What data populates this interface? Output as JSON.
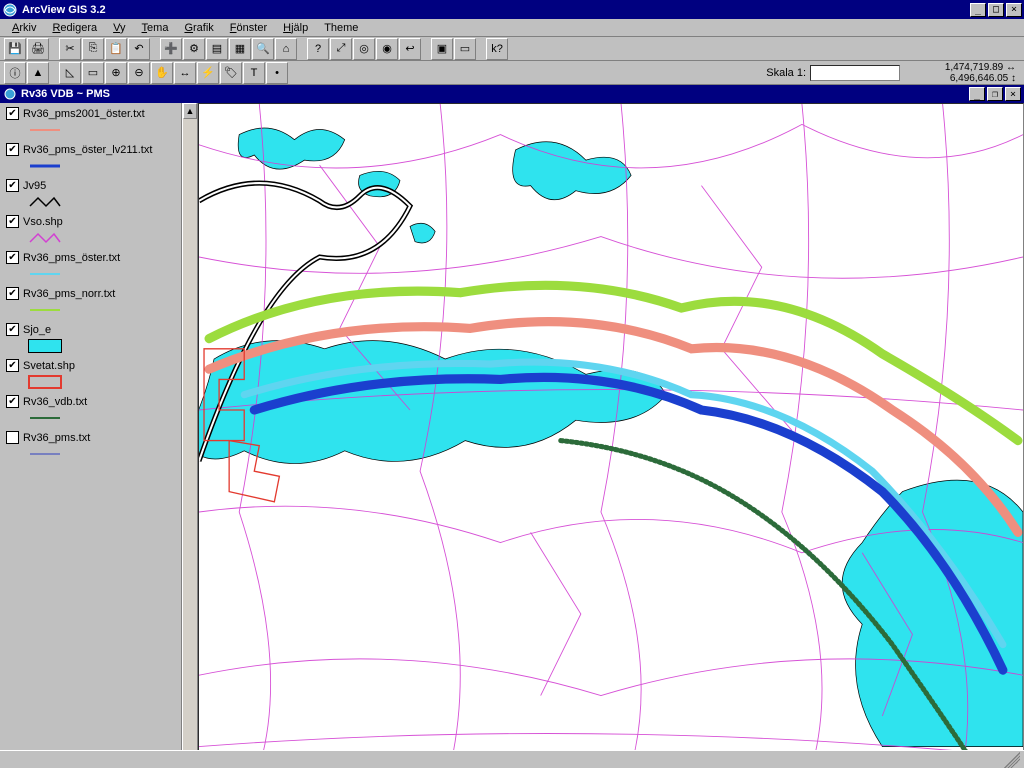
{
  "app": {
    "title": "ArcView GIS 3.2",
    "child_title": "Rv36 VDB ~ PMS"
  },
  "menu": {
    "items": [
      "Arkiv",
      "Redigera",
      "Vy",
      "Tema",
      "Grafik",
      "Fönster",
      "Hjälp",
      "Theme"
    ]
  },
  "toolbar1_icons": [
    "save-icon",
    "print-icon",
    "sep",
    "cut-icon",
    "copy-icon",
    "paste-icon",
    "undo-icon",
    "sep",
    "add-theme-icon",
    "theme-props-icon",
    "edit-legend-icon",
    "open-table-icon",
    "find-icon",
    "locate-address-icon",
    "sep",
    "query-icon",
    "zoom-full-icon",
    "zoom-active-icon",
    "zoom-selected-icon",
    "zoom-prev-icon",
    "sep",
    "select-by-theme-icon",
    "clear-selection-icon",
    "sep",
    "help-icon"
  ],
  "toolbar2_icons": [
    "identify-icon",
    "pointer-icon",
    "sep",
    "vertex-edit-icon",
    "select-feature-icon",
    "zoom-in-icon",
    "zoom-out-icon",
    "pan-icon",
    "measure-icon",
    "hotlink-icon",
    "label-icon",
    "text-icon",
    "draw-icon"
  ],
  "scale": {
    "label": "Skala 1:",
    "value": ""
  },
  "coords": {
    "x": "1,474,719.89",
    "y": "6,496,646.05"
  },
  "layers": [
    {
      "checked": true,
      "name": "Rv36_pms2001_öster.txt",
      "sw": {
        "type": "line",
        "color": "#ef8f7f",
        "w": 2
      }
    },
    {
      "checked": true,
      "name": "Rv36_pms_öster_lv211.txt",
      "sw": {
        "type": "line",
        "color": "#1b3fce",
        "w": 3
      }
    },
    {
      "checked": true,
      "name": "Jv95",
      "sw": {
        "type": "zig",
        "color": "#000000"
      }
    },
    {
      "checked": true,
      "name": "Vso.shp",
      "sw": {
        "type": "zig",
        "color": "#d23fd2"
      }
    },
    {
      "checked": true,
      "name": "Rv36_pms_öster.txt",
      "sw": {
        "type": "line",
        "color": "#5fd5f0",
        "w": 2
      }
    },
    {
      "checked": true,
      "name": "Rv36_pms_norr.txt",
      "sw": {
        "type": "line",
        "color": "#9cdc3e",
        "w": 2
      }
    },
    {
      "checked": true,
      "name": "Sjo_e",
      "sw": {
        "type": "fill",
        "color": "#2fe3ee"
      }
    },
    {
      "checked": true,
      "name": "Svetat.shp",
      "sw": {
        "type": "box",
        "color": "#e33a2f"
      }
    },
    {
      "checked": true,
      "name": "Rv36_vdb.txt",
      "sw": {
        "type": "line",
        "color": "#2c6b3a",
        "w": 2
      }
    },
    {
      "checked": false,
      "name": "Rv36_pms.txt",
      "sw": {
        "type": "line",
        "color": "#3040c0",
        "w": 1
      }
    }
  ],
  "colors": {
    "lake": "#2fe3ee",
    "roads": "#d23fd2",
    "rail": "#000000",
    "green": "#9cdc3e",
    "salmon": "#ef8f7f",
    "cyan": "#5fd5f0",
    "blue": "#1b3fce",
    "dkgrn": "#2c6b3a",
    "redbox": "#e33a2f"
  }
}
